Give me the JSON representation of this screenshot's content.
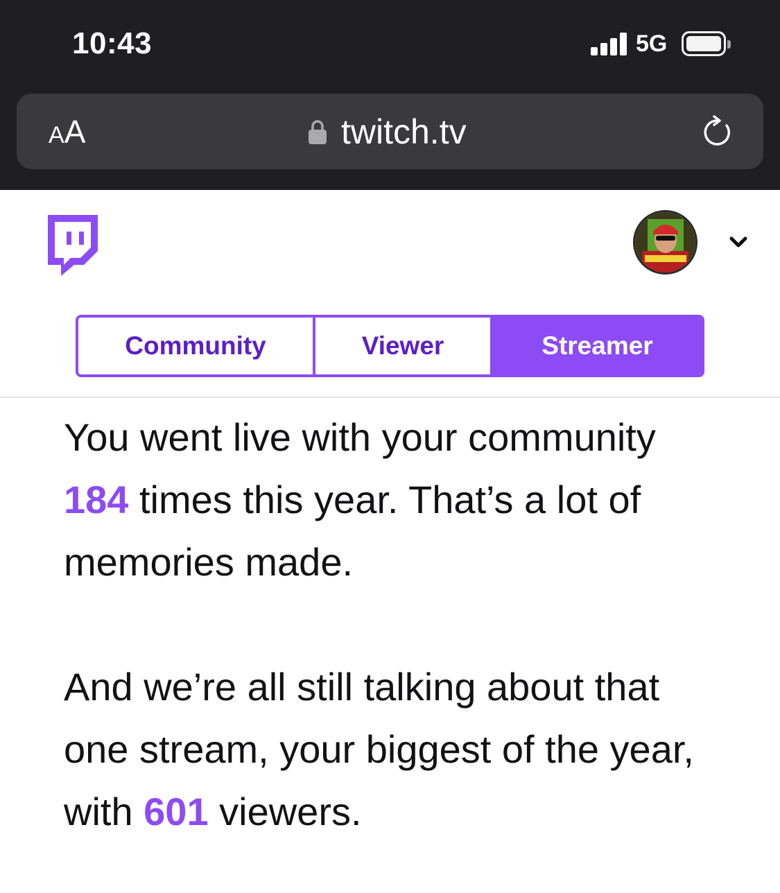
{
  "status_bar": {
    "time": "10:43",
    "network": "5G",
    "icons": [
      "signal-bars-icon",
      "battery-icon"
    ]
  },
  "browser": {
    "text_size_small": "A",
    "text_size_large": "A",
    "url": "twitch.tv",
    "icons": [
      "lock-icon",
      "reload-icon"
    ]
  },
  "header": {
    "logo": "twitch-logo-icon",
    "avatar": "user-avatar",
    "menu_icon": "chevron-down-icon"
  },
  "tabs": [
    {
      "label": "Community",
      "active": false
    },
    {
      "label": "Viewer",
      "active": false
    },
    {
      "label": "Streamer",
      "active": true
    }
  ],
  "content": {
    "para1": {
      "before": "You went live with your community ",
      "number": "184",
      "after": " times this year. That’s a lot of memories made."
    },
    "para2": {
      "before": "And we’re all still talking about that one stream, your biggest of the year, with ",
      "number": "601",
      "after": " viewers."
    }
  },
  "colors": {
    "brand_purple": "#8c4bf4",
    "tab_text_purple": "#5d1ec6",
    "chrome_dark": "#1f1f21",
    "address_bar": "#3a3a3c",
    "body_text": "#121214"
  }
}
